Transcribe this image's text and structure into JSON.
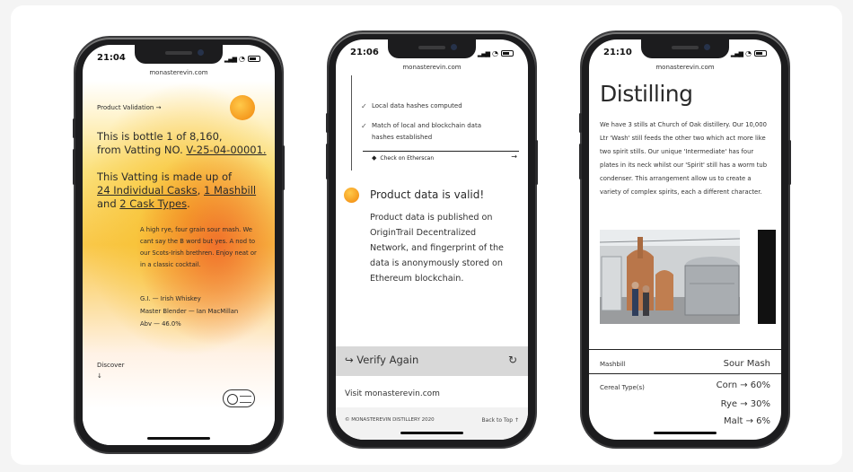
{
  "phones": [
    {
      "time": "21:04",
      "url": "monasterevin.com",
      "validation_link": "Product Validation →",
      "bottle_prefix": "This is bottle 1 of 8,160,",
      "vatting_prefix": "from Vatting NO.",
      "vatting_no": "V-25-04-00001.",
      "made_of": "This Vatting is made up of",
      "casks_link": "24 Individual Casks",
      "sep1": ",",
      "mashbill_link": "1 Mashbill",
      "and_word": "and",
      "cask_types_link": "2 Cask Types",
      "period": ".",
      "description": "A high rye, four grain sour mash. We cant say the B word but yes. A nod to our Scots-Irish brethren. Enjoy neat or in a classic cocktail.",
      "gi": "G.I. — Irish Whiskey",
      "blender": "Master Blender — Ian MacMillan",
      "abv": "Abv — 46.0%",
      "discover": "Discover",
      "discover_arrow": "↓"
    },
    {
      "time": "21:06",
      "url": "monasterevin.com",
      "checklist": [
        "Local data hashes computed",
        "Match of local and blockchain data hashes established"
      ],
      "etherscan": "Check on Etherscan",
      "etherscan_arrow": "→",
      "valid_title": "Product data is valid!",
      "valid_body": "Product data is published on OriginTrail Decentralized Network, and fingerprint of the data is anonymously stored on Ethereum blockchain.",
      "verify_again": "Verify Again",
      "visit": "Visit monasterevin.com",
      "copyright": "© MONASTEREVIN DISTILLERY 2020",
      "back_to_top": "Back to Top ↑"
    },
    {
      "time": "21:10",
      "url": "monasterevin.com",
      "title": "Distilling",
      "body": "We have 3 stills at Church of Oak distillery. Our 10,000 Ltr 'Wash' still feeds the other two which act more like two spirit stills. Our unique 'Intermediate' has four plates in its neck whilst our 'Spirit' still has a worm tub condenser. This arrangement allow us to create a variety of complex spirits, each a different character.",
      "mashbill_label": "Mashbill",
      "mashbill_value": "Sour Mash",
      "cereal_label": "Cereal Type(s)",
      "cereals": [
        "Corn → 60%",
        "Rye → 30%",
        "Malt → 6%"
      ]
    }
  ],
  "icons": [
    "arrow-right-icon",
    "check-icon",
    "ethereum-icon",
    "refresh-icon",
    "arrow-down-icon"
  ]
}
